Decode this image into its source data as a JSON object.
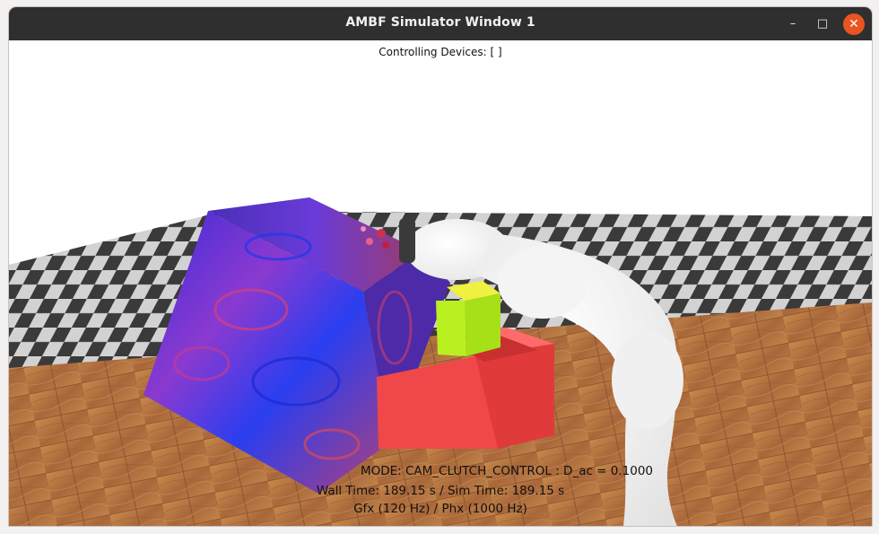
{
  "window": {
    "title": "AMBF Simulator Window 1",
    "controls": {
      "minimize": "–",
      "maximize": "□",
      "close": "✕"
    }
  },
  "hud": {
    "controlling_devices": "Controlling Devices: [  ]",
    "mode": "MODE: CAM_CLUTCH_CONTROL : D_ac = 0.1000",
    "time": "Wall Time: 189.15 s / Sim Time: 189.15 s",
    "rates": "Gfx (120 Hz) / Phx (1000 Hz)"
  },
  "colors": {
    "titlebar": "#2f2f2f",
    "close_button": "#e95420",
    "floor_wood": "#b8783f",
    "checker_dark": "#3a3a3a",
    "checker_light": "#cfcfcf",
    "red_block": "#f05050",
    "green_block": "#b8f020",
    "textured_box": "#5a3ad0",
    "robot_arm": "#f7f7f7"
  },
  "scene_objects": [
    "checkerboard-floor",
    "wooden-floor",
    "textured-cube",
    "red-block",
    "green-block",
    "robot-arm"
  ]
}
